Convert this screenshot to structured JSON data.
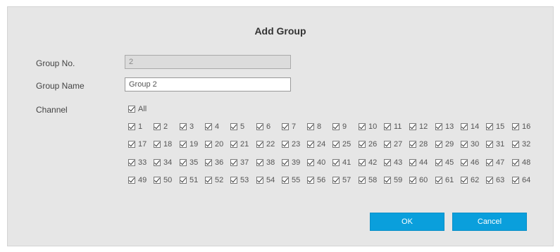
{
  "dialog": {
    "title": "Add Group",
    "group_no_label": "Group No.",
    "group_no_value": "2",
    "group_name_label": "Group Name",
    "group_name_value": "Group 2",
    "channel_label": "Channel",
    "all_label": "All",
    "all_checked": true,
    "channels": [
      {
        "label": "1",
        "checked": true
      },
      {
        "label": "2",
        "checked": true
      },
      {
        "label": "3",
        "checked": true
      },
      {
        "label": "4",
        "checked": true
      },
      {
        "label": "5",
        "checked": true
      },
      {
        "label": "6",
        "checked": true
      },
      {
        "label": "7",
        "checked": true
      },
      {
        "label": "8",
        "checked": true
      },
      {
        "label": "9",
        "checked": true
      },
      {
        "label": "10",
        "checked": true
      },
      {
        "label": "11",
        "checked": true
      },
      {
        "label": "12",
        "checked": true
      },
      {
        "label": "13",
        "checked": true
      },
      {
        "label": "14",
        "checked": true
      },
      {
        "label": "15",
        "checked": true
      },
      {
        "label": "16",
        "checked": true
      },
      {
        "label": "17",
        "checked": true
      },
      {
        "label": "18",
        "checked": true
      },
      {
        "label": "19",
        "checked": true
      },
      {
        "label": "20",
        "checked": true
      },
      {
        "label": "21",
        "checked": true
      },
      {
        "label": "22",
        "checked": true
      },
      {
        "label": "23",
        "checked": true
      },
      {
        "label": "24",
        "checked": true
      },
      {
        "label": "25",
        "checked": true
      },
      {
        "label": "26",
        "checked": true
      },
      {
        "label": "27",
        "checked": true
      },
      {
        "label": "28",
        "checked": true
      },
      {
        "label": "29",
        "checked": true
      },
      {
        "label": "30",
        "checked": true
      },
      {
        "label": "31",
        "checked": true
      },
      {
        "label": "32",
        "checked": true
      },
      {
        "label": "33",
        "checked": true
      },
      {
        "label": "34",
        "checked": true
      },
      {
        "label": "35",
        "checked": true
      },
      {
        "label": "36",
        "checked": true
      },
      {
        "label": "37",
        "checked": true
      },
      {
        "label": "38",
        "checked": true
      },
      {
        "label": "39",
        "checked": true
      },
      {
        "label": "40",
        "checked": true
      },
      {
        "label": "41",
        "checked": true
      },
      {
        "label": "42",
        "checked": true
      },
      {
        "label": "43",
        "checked": true
      },
      {
        "label": "44",
        "checked": true
      },
      {
        "label": "45",
        "checked": true
      },
      {
        "label": "46",
        "checked": true
      },
      {
        "label": "47",
        "checked": true
      },
      {
        "label": "48",
        "checked": true
      },
      {
        "label": "49",
        "checked": true
      },
      {
        "label": "50",
        "checked": true
      },
      {
        "label": "51",
        "checked": true
      },
      {
        "label": "52",
        "checked": true
      },
      {
        "label": "53",
        "checked": true
      },
      {
        "label": "54",
        "checked": true
      },
      {
        "label": "55",
        "checked": true
      },
      {
        "label": "56",
        "checked": true
      },
      {
        "label": "57",
        "checked": true
      },
      {
        "label": "58",
        "checked": true
      },
      {
        "label": "59",
        "checked": true
      },
      {
        "label": "60",
        "checked": true
      },
      {
        "label": "61",
        "checked": true
      },
      {
        "label": "62",
        "checked": true
      },
      {
        "label": "63",
        "checked": true
      },
      {
        "label": "64",
        "checked": true
      }
    ],
    "ok_label": "OK",
    "cancel_label": "Cancel"
  },
  "colors": {
    "dialog_bg": "#e6e6e6",
    "button_bg": "#0a9fdc",
    "button_text": "#ffffff"
  }
}
